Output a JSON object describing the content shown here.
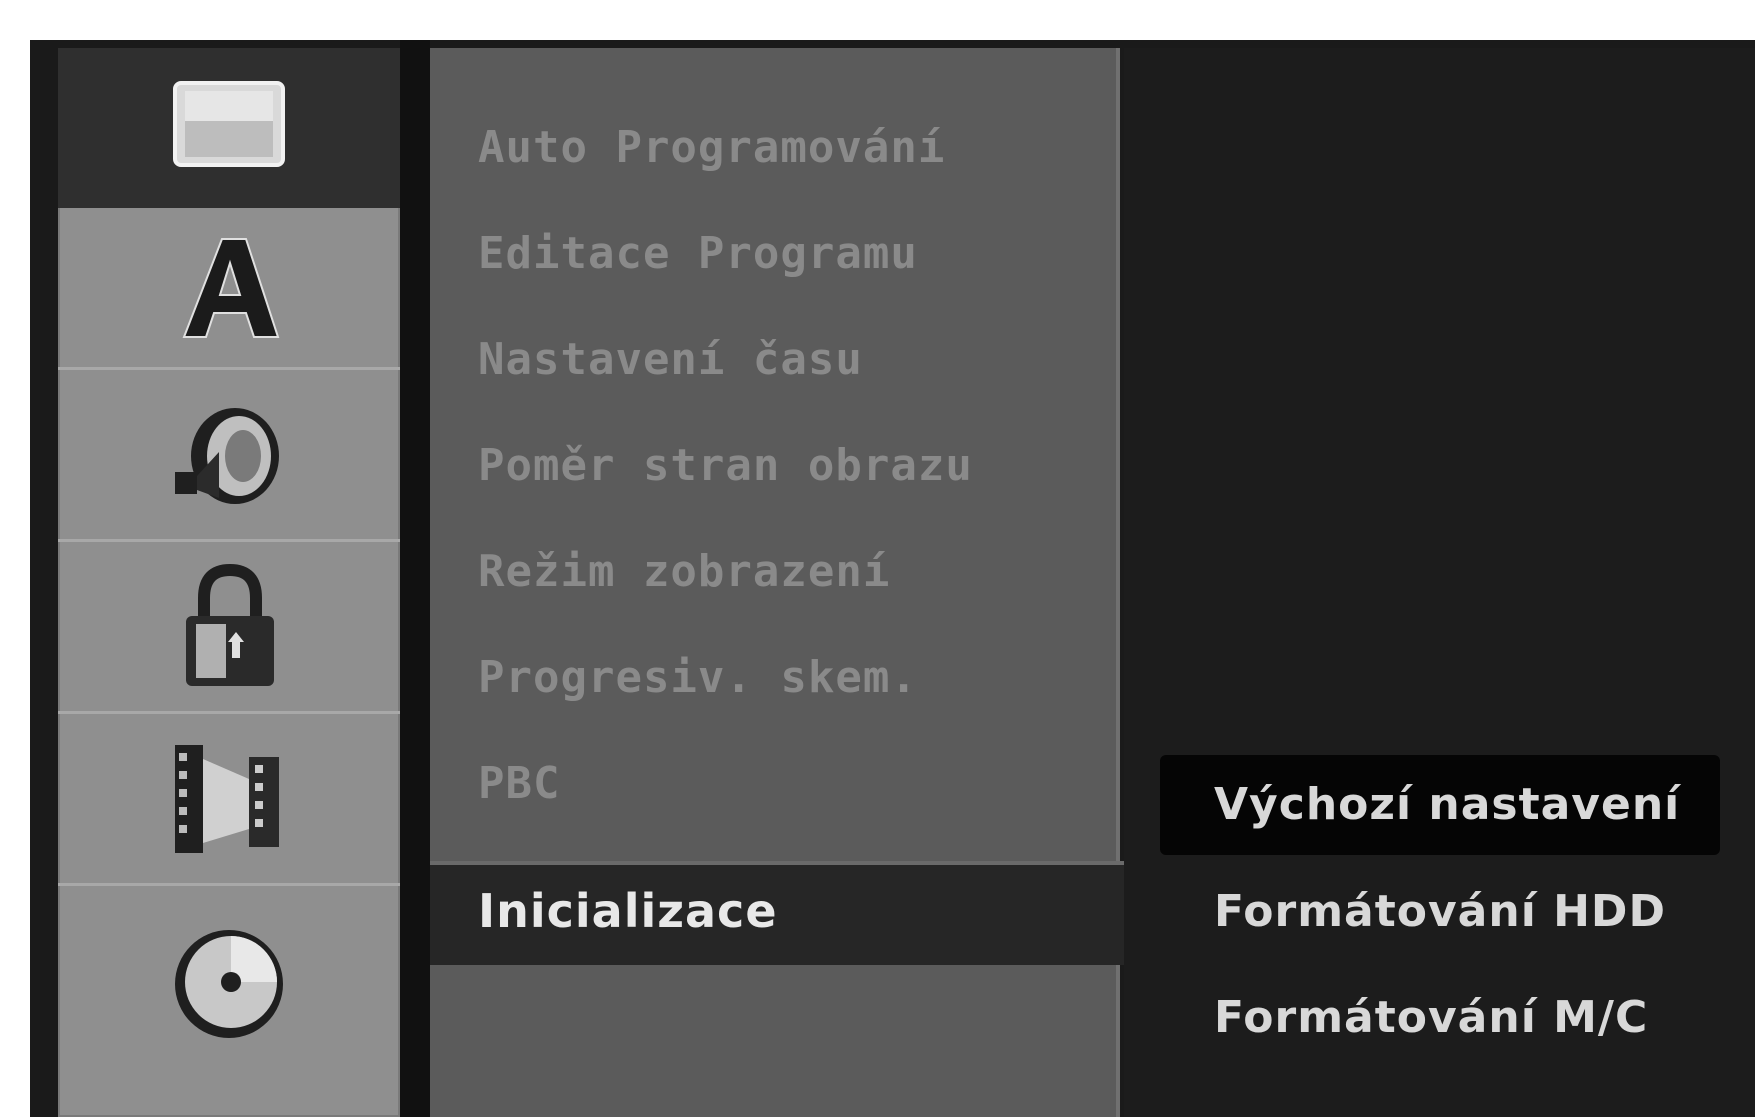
{
  "menu": {
    "items": [
      "Auto Programování",
      "Editace Programu",
      "Nastavení času",
      "Poměr stran obrazu",
      "Režim zobrazení",
      "Progresiv. skem.",
      "PBC"
    ],
    "selected": "Inicializace"
  },
  "submenu": {
    "items": [
      "Výchozí nastavení",
      "Formátování HDD",
      "Formátování M/C"
    ],
    "highlighted_index": 0
  },
  "categories": [
    {
      "icon": "monitor-icon",
      "active": true
    },
    {
      "icon": "language-icon",
      "active": false
    },
    {
      "icon": "audio-icon",
      "active": false
    },
    {
      "icon": "lock-icon",
      "active": false
    },
    {
      "icon": "film-icon",
      "active": false
    },
    {
      "icon": "disc-icon",
      "active": false
    }
  ],
  "colors": {
    "screen_bg": "#1a1a1a",
    "icon_column": "#8f8f8f",
    "menu_panel": "#5b5b5b",
    "selected_bg": "#262626",
    "text_active": "#e8e8e8",
    "text_dim": "#8a8a8a"
  }
}
